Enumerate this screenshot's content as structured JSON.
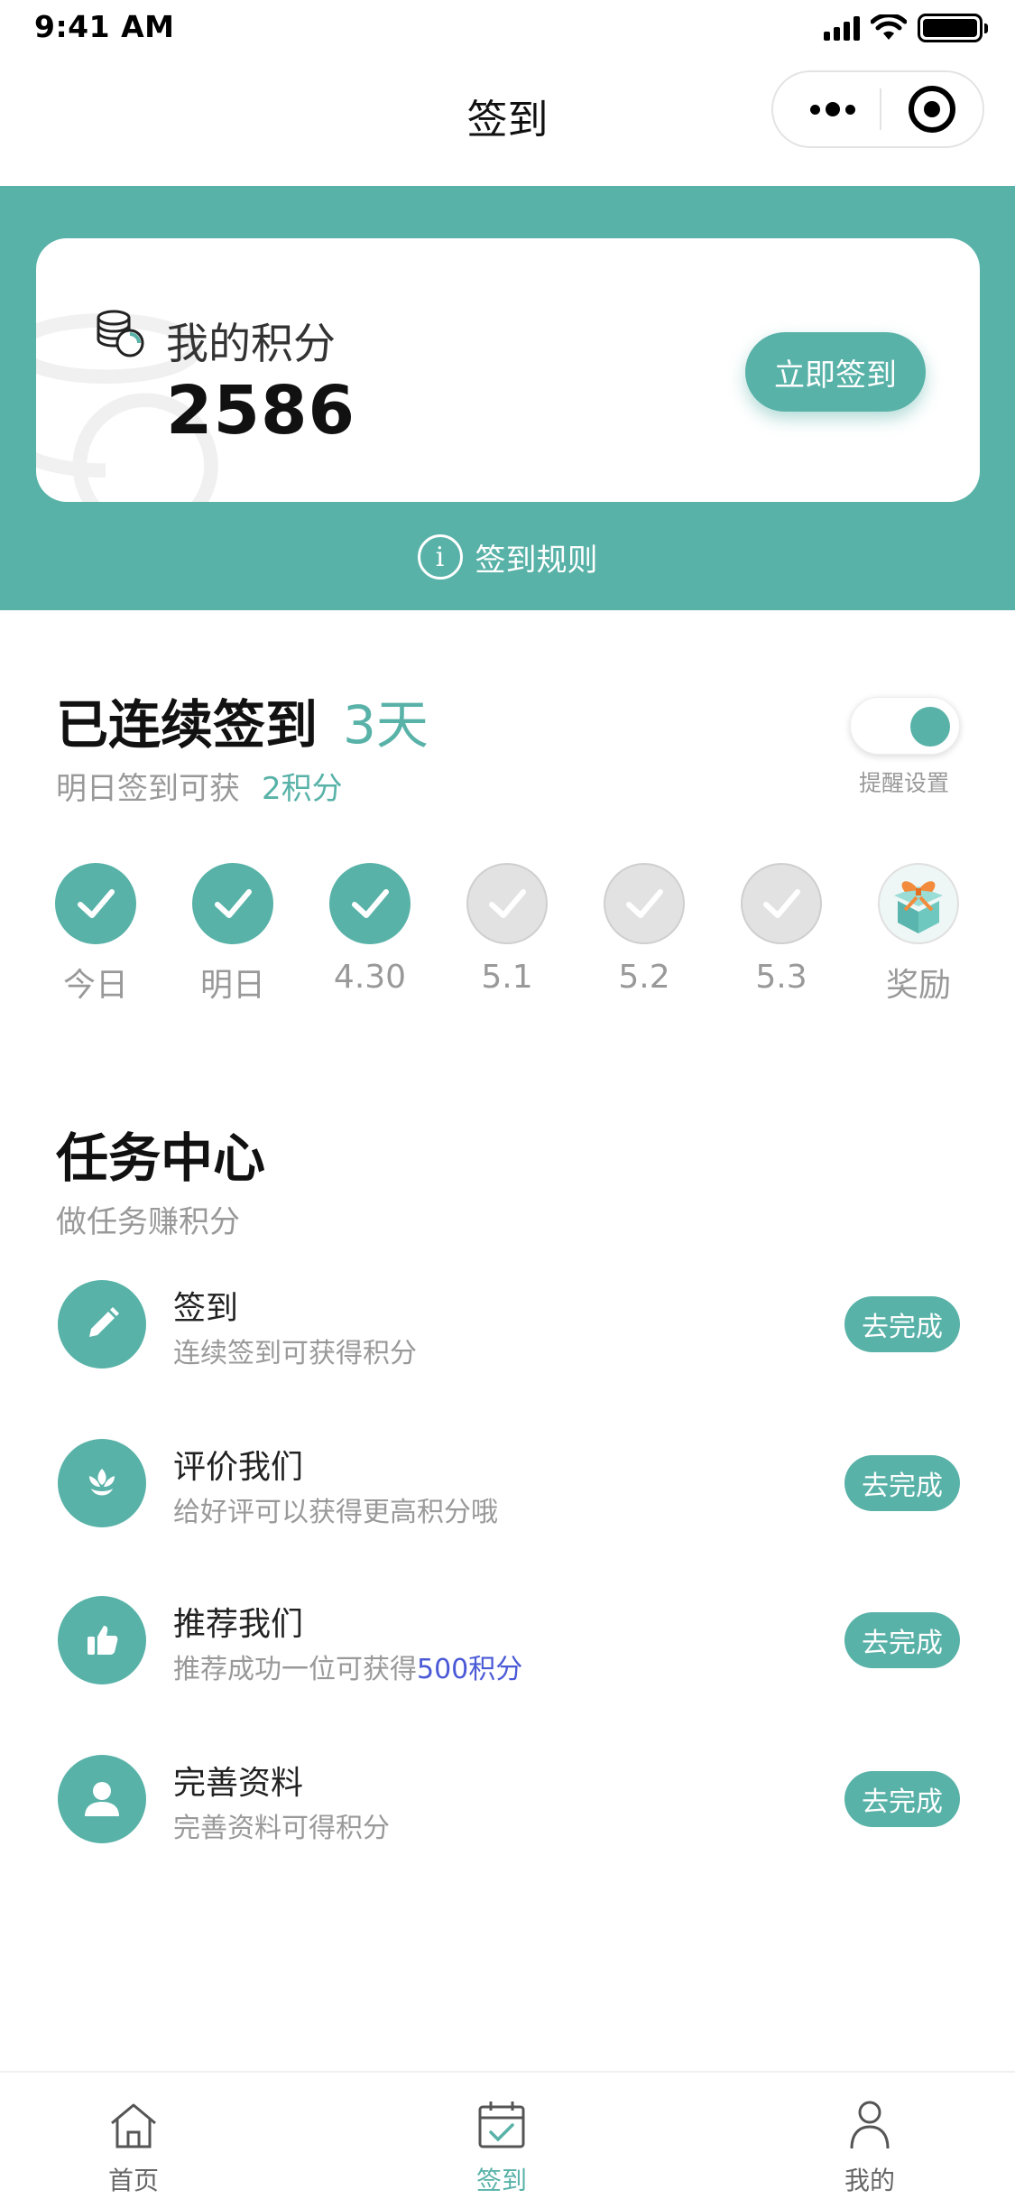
{
  "status_bar": {
    "time": "9:41 AM"
  },
  "nav": {
    "title": "签到"
  },
  "points_card": {
    "label": "我的积分",
    "value": "2586",
    "signin_button": "立即签到"
  },
  "rules": {
    "label": "签到规则",
    "icon_glyph": "i"
  },
  "streak": {
    "title": "已连续签到",
    "days": "3天",
    "subtitle": "明日签到可获",
    "points": "2积分",
    "reminder_label": "提醒设置",
    "reminder_on": true
  },
  "days": [
    {
      "label": "今日",
      "status": "done"
    },
    {
      "label": "明日",
      "status": "done"
    },
    {
      "label": "4.30",
      "status": "done"
    },
    {
      "label": "5.1",
      "status": "todo"
    },
    {
      "label": "5.2",
      "status": "todo"
    },
    {
      "label": "5.3",
      "status": "todo"
    },
    {
      "label": "奖励",
      "status": "gift"
    }
  ],
  "tasks": {
    "title": "任务中心",
    "subtitle": "做任务赚积分",
    "items": [
      {
        "name": "签到",
        "desc": "连续签到可获得积分",
        "button": "去完成",
        "icon": "pencil-icon"
      },
      {
        "name": "评价我们",
        "desc": "给好评可以获得更高积分哦",
        "button": "去完成",
        "icon": "flower-icon"
      },
      {
        "name": "推荐我们",
        "desc": "推荐成功一位可获得",
        "desc_highlight": "500积分",
        "button": "去完成",
        "icon": "thumbs-up-icon"
      },
      {
        "name": "完善资料",
        "desc": "完善资料可得积分",
        "button": "去完成",
        "icon": "user-icon"
      }
    ]
  },
  "tabbar": {
    "items": [
      {
        "label": "首页",
        "icon": "home-icon",
        "active": false
      },
      {
        "label": "签到",
        "icon": "calendar-check-icon",
        "active": true
      },
      {
        "label": "我的",
        "icon": "person-icon",
        "active": false
      }
    ]
  },
  "colors": {
    "accent": "#58b2a8",
    "highlight": "#4a59d6",
    "muted_text": "#999999"
  }
}
